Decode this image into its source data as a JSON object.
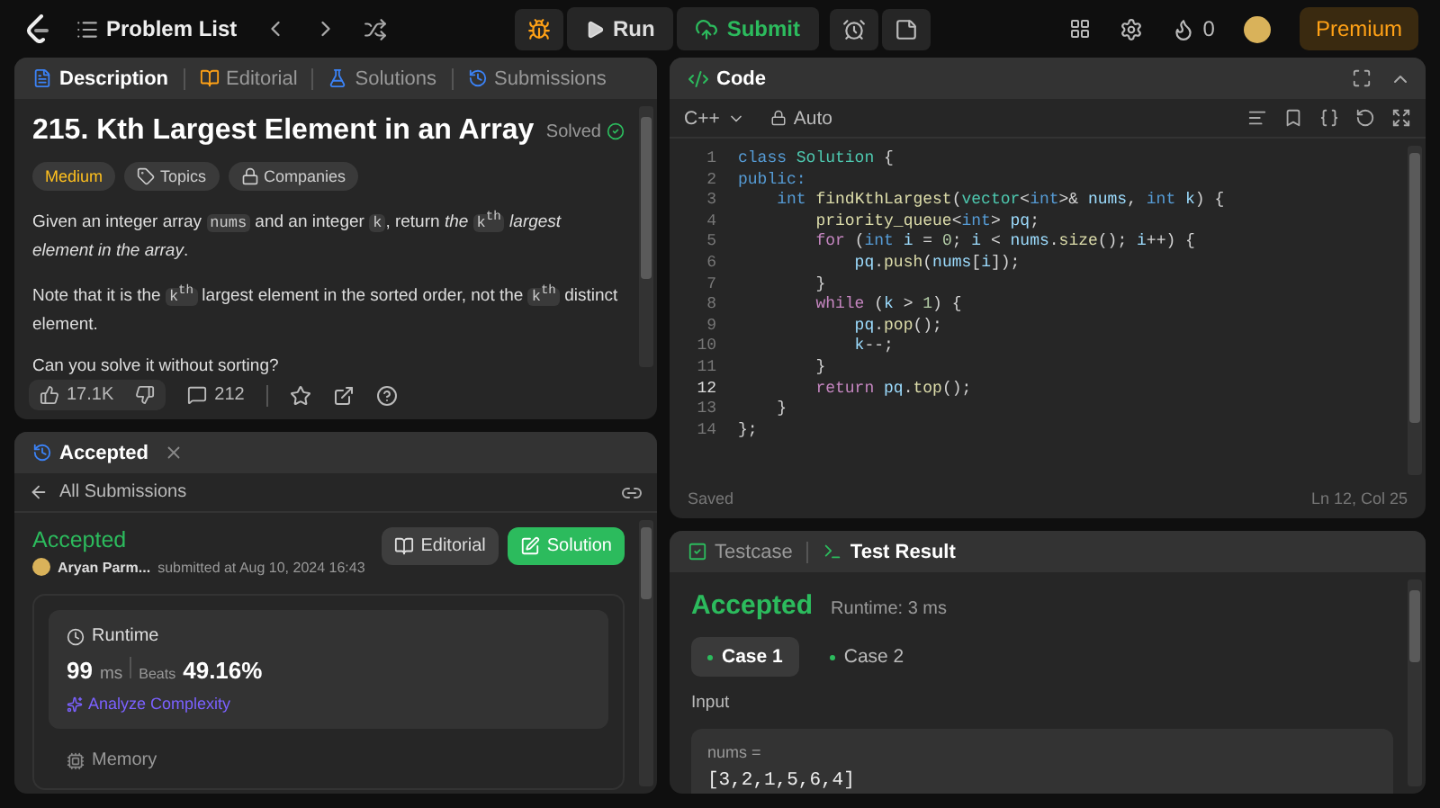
{
  "topbar": {
    "problem_list": "Problem List",
    "run": "Run",
    "submit": "Submit",
    "streak": "0",
    "premium": "Premium"
  },
  "description_panel": {
    "tabs": [
      {
        "label": "Description",
        "selected": true
      },
      {
        "label": "Editorial",
        "selected": false
      },
      {
        "label": "Solutions",
        "selected": false
      },
      {
        "label": "Submissions",
        "selected": false
      }
    ],
    "title": "215. Kth Largest Element in an Array",
    "status": "Solved",
    "tags": [
      {
        "kind": "difficulty",
        "label": "Medium"
      },
      {
        "kind": "topics",
        "label": "Topics"
      },
      {
        "kind": "companies",
        "label": "Companies"
      }
    ],
    "paragraphs": [
      [
        {
          "kind": "text",
          "text": "Given an integer array "
        },
        {
          "kind": "code",
          "text": "nums"
        },
        {
          "kind": "text",
          "text": " and an integer "
        },
        {
          "kind": "code",
          "text": "k"
        },
        {
          "kind": "text",
          "text": ", return "
        },
        {
          "kind": "em",
          "text": "the "
        },
        {
          "kind": "code",
          "text": "k",
          "sup": "th"
        },
        {
          "kind": "em",
          "text": " largest element in the array"
        },
        {
          "kind": "text",
          "text": "."
        }
      ],
      [
        {
          "kind": "text",
          "text": "Note that it is the "
        },
        {
          "kind": "code",
          "text": "k",
          "sup": "th"
        },
        {
          "kind": "text",
          "text": " largest element in the sorted order, not the "
        },
        {
          "kind": "code",
          "text": "k",
          "sup": "th"
        },
        {
          "kind": "text",
          "text": " distinct element."
        }
      ],
      [
        {
          "kind": "text",
          "text": "Can you solve it without sorting?"
        }
      ]
    ],
    "likes": "17.1K",
    "comments": "212"
  },
  "submission_panel": {
    "tab": "Accepted",
    "back_link": "All Submissions",
    "status": "Accepted",
    "user": "Aryan Parm...",
    "submitted": "submitted at Aug 10, 2024 16:43",
    "buttons": [
      {
        "kind": "editorial",
        "label": "Editorial"
      },
      {
        "kind": "solution",
        "label": "Solution"
      }
    ],
    "runtime": {
      "label": "Runtime",
      "value": "99",
      "unit": "ms",
      "beats_label": "Beats",
      "beats": "49.16%",
      "analyze": "Analyze Complexity"
    },
    "memory": {
      "label": "Memory"
    }
  },
  "code_panel": {
    "title": "Code",
    "language": "C++",
    "mode": "Auto",
    "lines": [
      {
        "number": "1",
        "active": false,
        "tokens": [
          {
            "kind": "kw",
            "text": "class "
          },
          {
            "kind": "type",
            "text": "Solution"
          },
          {
            "kind": "p",
            "text": " {"
          }
        ]
      },
      {
        "number": "2",
        "active": false,
        "tokens": [
          {
            "kind": "kw",
            "text": "public:"
          }
        ]
      },
      {
        "number": "3",
        "active": false,
        "tokens": [
          {
            "kind": "kw",
            "text": "    int "
          },
          {
            "kind": "fn",
            "text": "findKthLargest"
          },
          {
            "kind": "p",
            "text": "("
          },
          {
            "kind": "type",
            "text": "vector"
          },
          {
            "kind": "p",
            "text": "<"
          },
          {
            "kind": "kw",
            "text": "int"
          },
          {
            "kind": "p",
            "text": ">& "
          },
          {
            "kind": "var",
            "text": "nums"
          },
          {
            "kind": "p",
            "text": ", "
          },
          {
            "kind": "kw",
            "text": "int "
          },
          {
            "kind": "var",
            "text": "k"
          },
          {
            "kind": "p",
            "text": ") {"
          }
        ]
      },
      {
        "number": "4",
        "active": false,
        "tokens": [
          {
            "kind": "fn",
            "text": "        priority_queue"
          },
          {
            "kind": "p",
            "text": "<"
          },
          {
            "kind": "kw",
            "text": "int"
          },
          {
            "kind": "p",
            "text": "> "
          },
          {
            "kind": "var",
            "text": "pq"
          },
          {
            "kind": "p",
            "text": ";"
          }
        ]
      },
      {
        "number": "5",
        "active": false,
        "tokens": [
          {
            "kind": "ctl",
            "text": "        for"
          },
          {
            "kind": "p",
            "text": " ("
          },
          {
            "kind": "kw",
            "text": "int "
          },
          {
            "kind": "var",
            "text": "i"
          },
          {
            "kind": "p",
            "text": " = "
          },
          {
            "kind": "num",
            "text": "0"
          },
          {
            "kind": "p",
            "text": "; "
          },
          {
            "kind": "var",
            "text": "i"
          },
          {
            "kind": "p",
            "text": " < "
          },
          {
            "kind": "var",
            "text": "nums"
          },
          {
            "kind": "p",
            "text": "."
          },
          {
            "kind": "fn",
            "text": "size"
          },
          {
            "kind": "p",
            "text": "(); "
          },
          {
            "kind": "var",
            "text": "i"
          },
          {
            "kind": "p",
            "text": "++) {"
          }
        ]
      },
      {
        "number": "6",
        "active": false,
        "tokens": [
          {
            "kind": "var",
            "text": "            pq"
          },
          {
            "kind": "p",
            "text": "."
          },
          {
            "kind": "fn",
            "text": "push"
          },
          {
            "kind": "p",
            "text": "("
          },
          {
            "kind": "var",
            "text": "nums"
          },
          {
            "kind": "p",
            "text": "["
          },
          {
            "kind": "var",
            "text": "i"
          },
          {
            "kind": "p",
            "text": "]);"
          }
        ]
      },
      {
        "number": "7",
        "active": false,
        "tokens": [
          {
            "kind": "p",
            "text": "        }"
          }
        ]
      },
      {
        "number": "8",
        "active": false,
        "tokens": [
          {
            "kind": "ctl",
            "text": "        while"
          },
          {
            "kind": "p",
            "text": " ("
          },
          {
            "kind": "var",
            "text": "k"
          },
          {
            "kind": "p",
            "text": " > "
          },
          {
            "kind": "num",
            "text": "1"
          },
          {
            "kind": "p",
            "text": ") {"
          }
        ]
      },
      {
        "number": "9",
        "active": false,
        "tokens": [
          {
            "kind": "var",
            "text": "            pq"
          },
          {
            "kind": "p",
            "text": "."
          },
          {
            "kind": "fn",
            "text": "pop"
          },
          {
            "kind": "p",
            "text": "();"
          }
        ]
      },
      {
        "number": "10",
        "active": false,
        "tokens": [
          {
            "kind": "var",
            "text": "            k"
          },
          {
            "kind": "p",
            "text": "--;"
          }
        ]
      },
      {
        "number": "11",
        "active": false,
        "tokens": [
          {
            "kind": "p",
            "text": "        }"
          }
        ]
      },
      {
        "number": "12",
        "active": true,
        "tokens": [
          {
            "kind": "ctl",
            "text": "        return "
          },
          {
            "kind": "var",
            "text": "pq"
          },
          {
            "kind": "p",
            "text": "."
          },
          {
            "kind": "fn",
            "text": "top"
          },
          {
            "kind": "p",
            "text": "();"
          }
        ]
      },
      {
        "number": "13",
        "active": false,
        "tokens": [
          {
            "kind": "p",
            "text": "    }"
          }
        ]
      },
      {
        "number": "14",
        "active": false,
        "tokens": [
          {
            "kind": "p",
            "text": "};"
          }
        ]
      }
    ],
    "saved": "Saved",
    "cursor": "Ln 12, Col 25"
  },
  "test_panel": {
    "tabs": [
      {
        "label": "Testcase",
        "selected": false
      },
      {
        "label": "Test Result",
        "selected": true
      }
    ],
    "status": "Accepted",
    "runtime": "Runtime: 3 ms",
    "cases": [
      {
        "label": "Case 1",
        "selected": true
      },
      {
        "label": "Case 2",
        "selected": false
      }
    ],
    "input_label": "Input",
    "param": "nums =",
    "value": "[3,2,1,5,6,4]"
  }
}
